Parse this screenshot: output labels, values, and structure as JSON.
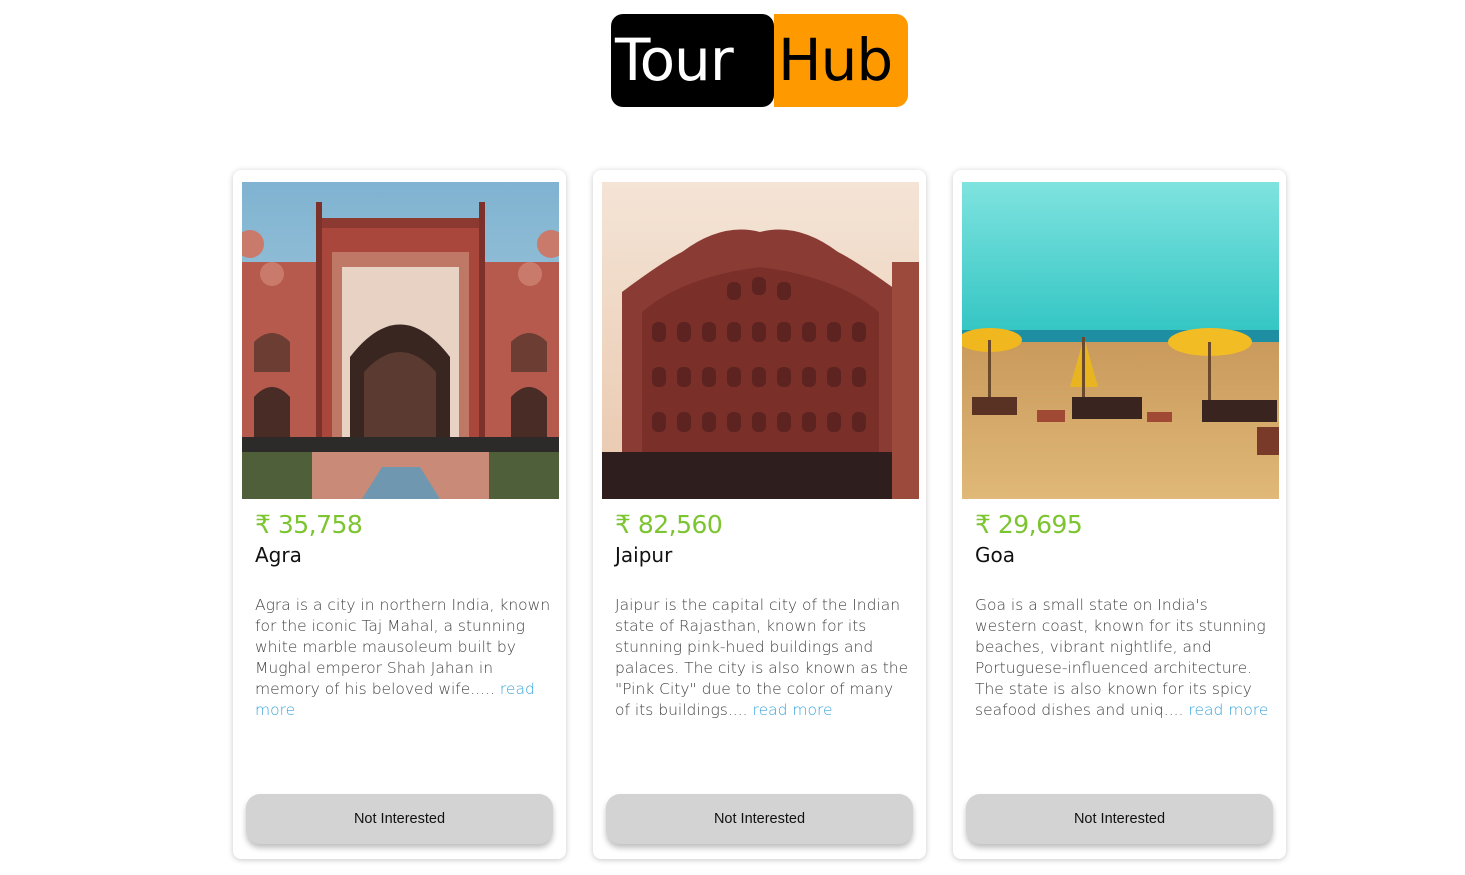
{
  "logo": {
    "part1": "Tour",
    "part2": "Hub"
  },
  "colors": {
    "price": "#7cc531",
    "link": "#3aa4dc",
    "logo_accent": "#ff9900",
    "button_bg": "#d3d3d3"
  },
  "cards": [
    {
      "price": "₹ 35,758",
      "city": "Agra",
      "description": "Agra is a city in northern India, known for the iconic Taj Mahal, a stunning white marble mausoleum built by Mughal emperor Shah Jahan in memory of his beloved wife.....",
      "read_more": "read more",
      "button": "Not Interested",
      "image": "taj-mahal-gate-photo"
    },
    {
      "price": "₹ 82,560",
      "city": "Jaipur",
      "description": "Jaipur is the capital city of the Indian state of Rajasthan, known for its stunning pink-hued buildings and palaces. The city is also known as the \"Pink City\" due to the color of many of its buildings....",
      "read_more": "read more",
      "button": "Not Interested",
      "image": "hawa-mahal-photo"
    },
    {
      "price": "₹ 29,695",
      "city": "Goa",
      "description": "Goa is a small state on India's western coast, known for its stunning beaches, vibrant nightlife, and Portuguese-influenced architecture. The state is also known for its spicy seafood dishes and uniq....",
      "read_more": "read more",
      "button": "Not Interested",
      "image": "goa-beach-photo"
    }
  ]
}
